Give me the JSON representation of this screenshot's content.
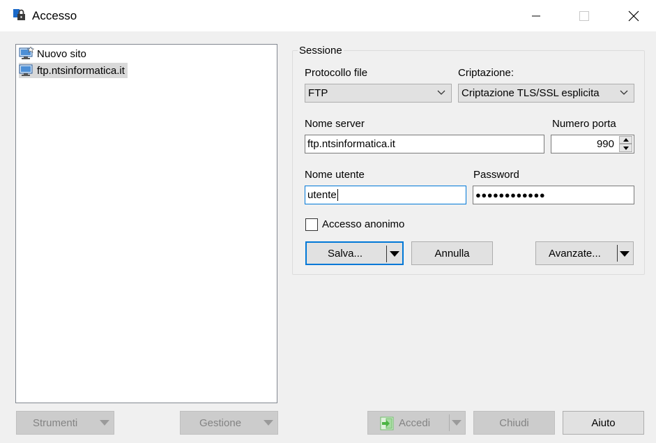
{
  "window": {
    "title": "Accesso"
  },
  "sites": [
    {
      "label": "Nuovo sito",
      "icon": "new-site-icon"
    },
    {
      "label": "ftp.ntsinformatica.it",
      "icon": "computer-icon"
    }
  ],
  "session": {
    "group_label": "Sessione",
    "protocol_label": "Protocollo file",
    "protocol_value": "FTP",
    "encryption_label": "Criptazione:",
    "encryption_value": "Criptazione TLS/SSL esplicita",
    "server_label": "Nome server",
    "server_value": "ftp.ntsinformatica.it",
    "port_label": "Numero porta",
    "port_value": "990",
    "user_label": "Nome utente",
    "user_value": "utente",
    "password_label": "Password",
    "password_value": "●●●●●●●●●●●●",
    "anonymous_label": "Accesso anonimo",
    "anonymous_checked": false,
    "save_label": "Salva...",
    "cancel_label": "Annulla",
    "advanced_label": "Avanzate..."
  },
  "footer": {
    "tools_label": "Strumenti",
    "manage_label": "Gestione",
    "login_label": "Accedi",
    "close_label": "Chiudi",
    "help_label": "Aiuto"
  },
  "colors": {
    "accent": "#0078d7",
    "disabled_text": "#838383",
    "selection": "#d9d9d9"
  }
}
